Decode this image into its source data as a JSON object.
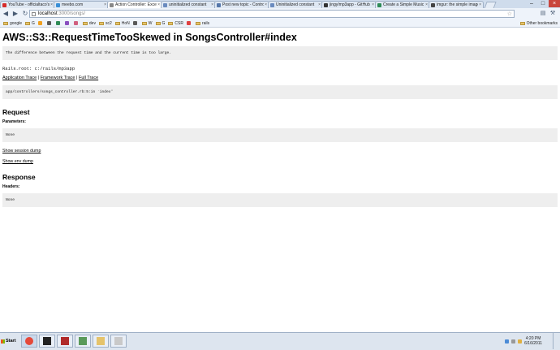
{
  "browser": {
    "tabs": [
      {
        "label": "YouTube - officialtaco's",
        "color": "#d62b2b",
        "active": false
      },
      {
        "label": "meebo.com",
        "color": "#3a8fd6",
        "active": false
      },
      {
        "label": "Action Controller: Except",
        "color": "#888888",
        "active": true
      },
      {
        "label": "uninitialized constant",
        "color": "#6a8bbf",
        "active": false
      },
      {
        "label": "Post new topic - Control",
        "color": "#5577aa",
        "active": false
      },
      {
        "label": "Uninitialized constant",
        "color": "#6a8bbf",
        "active": false
      },
      {
        "label": "jingy/mp3app - GitHub",
        "color": "#333333",
        "active": false
      },
      {
        "label": "Create a Simple Music St",
        "color": "#2e8b57",
        "active": false
      },
      {
        "label": "imgur: the simple image",
        "color": "#444444",
        "active": false
      }
    ],
    "address": {
      "host": "localhost",
      "path": ":3000/songs/"
    },
    "bookmarks": [
      {
        "label": "google",
        "type": "folder"
      },
      {
        "label": "G",
        "type": "folder"
      },
      {
        "label": "",
        "type": "icon"
      },
      {
        "label": "",
        "type": "icon"
      },
      {
        "label": "",
        "type": "icon"
      },
      {
        "label": "",
        "type": "icon"
      },
      {
        "label": "",
        "type": "icon"
      },
      {
        "label": "dev",
        "type": "folder"
      },
      {
        "label": "sc2",
        "type": "folder"
      },
      {
        "label": "HoN",
        "type": "folder"
      },
      {
        "label": "",
        "type": "icon"
      },
      {
        "label": "W",
        "type": "folder"
      },
      {
        "label": "G",
        "type": "folder"
      },
      {
        "label": "CSR",
        "type": "folder"
      },
      {
        "label": "",
        "type": "icon"
      },
      {
        "label": "rails",
        "type": "folder"
      }
    ],
    "other_bookmarks": "Other bookmarks"
  },
  "page": {
    "title": "AWS::S3::RequestTimeTooSkewed in SongsController#index",
    "message": "The difference between the request time and the current time is too large.",
    "rails_root": "Rails.root: c:/rails/mp3app",
    "traces": {
      "application": "Application Trace",
      "framework": "Framework Trace",
      "full": "Full Trace",
      "sep": "|"
    },
    "trace_line": "app/controllers/songs_controller.rb:5:in `index'",
    "request": {
      "heading": "Request",
      "parameters_label": "Parameters:",
      "parameters_value": "None",
      "show_session": "Show session dump",
      "show_env": "Show env dump"
    },
    "response": {
      "heading": "Response",
      "headers_label": "Headers:",
      "headers_value": "None"
    }
  },
  "taskbar": {
    "start": "Start",
    "apps": [
      {
        "name": "chrome-icon",
        "active": true
      },
      {
        "name": "terminal-icon",
        "active": false
      },
      {
        "name": "ruby-icon",
        "active": false
      },
      {
        "name": "notepad-icon",
        "active": false
      },
      {
        "name": "explorer-icon",
        "active": false
      },
      {
        "name": "paint-icon",
        "active": false
      }
    ],
    "time": "4:20 PM",
    "date": "6/16/2011"
  }
}
